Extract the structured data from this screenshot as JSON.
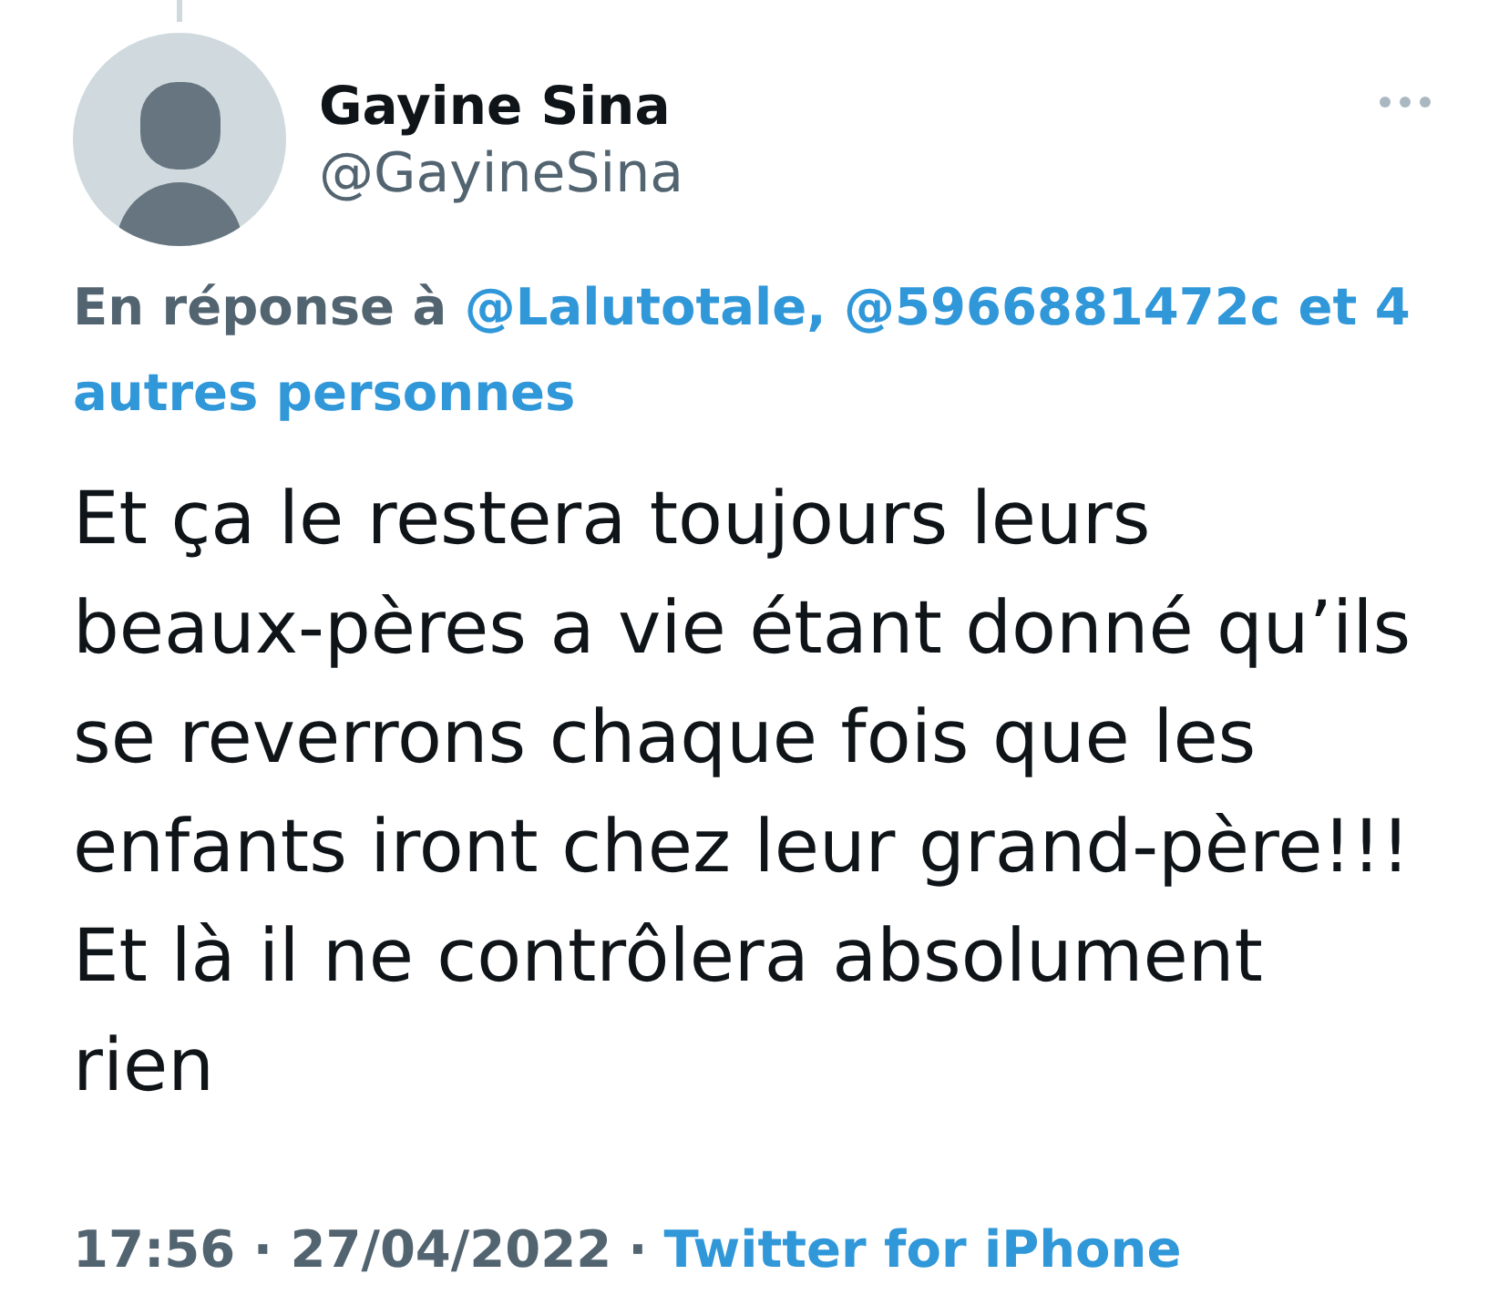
{
  "tweet": {
    "connected_above": true,
    "author": {
      "name": "Gayine Sina",
      "handle": "@GayineSina"
    },
    "reply_to": {
      "label": "En réponse à",
      "links": [
        "@Lalutotale,",
        "@5966881472c",
        "et 4",
        "autres personnes"
      ]
    },
    "text": "Et ça le restera toujours leurs beaux-pères a vie étant donné qu’ils se reverrons chaque fois que les enfants iront chez leur grand-père!!! Et là il ne contrôlera absolument rien",
    "footer": {
      "timestamp": "17:56 · 27/04/2022",
      "separator": "·",
      "source": "Twitter for iPhone"
    }
  }
}
